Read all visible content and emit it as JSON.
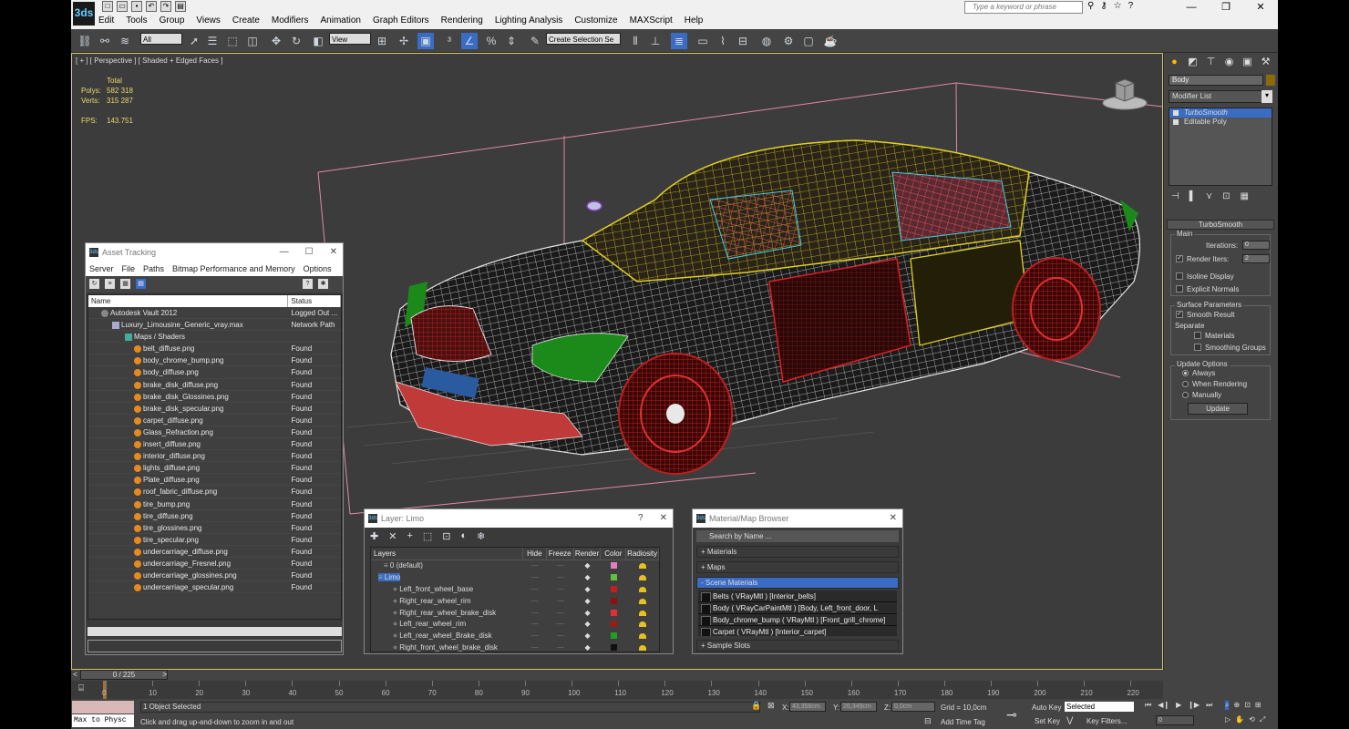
{
  "app": {
    "menus": [
      "Edit",
      "Tools",
      "Group",
      "Views",
      "Create",
      "Modifiers",
      "Animation",
      "Graph Editors",
      "Rendering",
      "Lighting Analysis",
      "Customize",
      "MAXScript",
      "Help"
    ],
    "search_placeholder": "Type a keyword or phrase",
    "logo_text": "3ds"
  },
  "toolbar": {
    "filter_value": "All",
    "coord_value": "View",
    "selection_set_placeholder": "Create Selection Se"
  },
  "viewport": {
    "label": "[ + ] [ Perspective ] [ Shaded + Edged Faces ]",
    "stats": {
      "header": "Total",
      "polys_label": "Polys:",
      "polys_value": "582 318",
      "verts_label": "Verts:",
      "verts_value": "315 287",
      "fps_label": "FPS:",
      "fps_value": "143.751"
    }
  },
  "command_panel": {
    "object_name": "Body",
    "modifier_list": "Modifier List",
    "stack": [
      "TurboSmooth",
      "Editable Poly"
    ],
    "rollout_title": "TurboSmooth",
    "main_label": "Main",
    "iterations_label": "Iterations:",
    "iterations_value": "0",
    "render_iters_label": "Render Iters:",
    "render_iters_value": "2",
    "isoline_label": "Isoline Display",
    "explicit_normals_label": "Explicit Normals",
    "surface_params_label": "Surface Parameters",
    "smooth_result_label": "Smooth Result",
    "separate_label": "Separate",
    "materials_label": "Materials",
    "smoothing_groups_label": "Smoothing Groups",
    "update_options_label": "Update Options",
    "always_label": "Always",
    "when_rendering_label": "When Rendering",
    "manually_label": "Manually",
    "update_button": "Update"
  },
  "asset_tracking": {
    "title": "Asset Tracking",
    "menus": [
      "Server",
      "File",
      "Paths",
      "Bitmap Performance and Memory",
      "Options"
    ],
    "col_name": "Name",
    "col_status": "Status",
    "rows": [
      {
        "name": "Autodesk Vault 2012",
        "status": "Logged Out ...",
        "indent": 0,
        "kind": "vault"
      },
      {
        "name": "Luxury_Limousine_Generic_vray.max",
        "status": "Network Path",
        "indent": 1,
        "kind": "file"
      },
      {
        "name": "Maps / Shaders",
        "status": "",
        "indent": 2,
        "kind": "map"
      },
      {
        "name": "belt_diffuse.png",
        "status": "Found",
        "indent": 3,
        "kind": "img"
      },
      {
        "name": "body_chrome_bump.png",
        "status": "Found",
        "indent": 3,
        "kind": "img"
      },
      {
        "name": "body_diffuse.png",
        "status": "Found",
        "indent": 3,
        "kind": "img"
      },
      {
        "name": "brake_disk_diffuse.png",
        "status": "Found",
        "indent": 3,
        "kind": "img"
      },
      {
        "name": "brake_disk_Glossines.png",
        "status": "Found",
        "indent": 3,
        "kind": "img"
      },
      {
        "name": "brake_disk_specular.png",
        "status": "Found",
        "indent": 3,
        "kind": "img"
      },
      {
        "name": "carpet_diffuse.png",
        "status": "Found",
        "indent": 3,
        "kind": "img"
      },
      {
        "name": "Glass_Refraction.png",
        "status": "Found",
        "indent": 3,
        "kind": "img"
      },
      {
        "name": "insert_diffuse.png",
        "status": "Found",
        "indent": 3,
        "kind": "img"
      },
      {
        "name": "interior_diffuse.png",
        "status": "Found",
        "indent": 3,
        "kind": "img"
      },
      {
        "name": "lights_diffuse.png",
        "status": "Found",
        "indent": 3,
        "kind": "img"
      },
      {
        "name": "Plate_diffuse.png",
        "status": "Found",
        "indent": 3,
        "kind": "img"
      },
      {
        "name": "roof_fabric_diffuse.png",
        "status": "Found",
        "indent": 3,
        "kind": "img"
      },
      {
        "name": "tire_bump.png",
        "status": "Found",
        "indent": 3,
        "kind": "img"
      },
      {
        "name": "tire_diffuse.png",
        "status": "Found",
        "indent": 3,
        "kind": "img"
      },
      {
        "name": "tire_glossines.png",
        "status": "Found",
        "indent": 3,
        "kind": "img"
      },
      {
        "name": "tire_specular.png",
        "status": "Found",
        "indent": 3,
        "kind": "img"
      },
      {
        "name": "undercarriage_diffuse.png",
        "status": "Found",
        "indent": 3,
        "kind": "img"
      },
      {
        "name": "undercarriage_Fresnel.png",
        "status": "Found",
        "indent": 3,
        "kind": "img"
      },
      {
        "name": "undercarriage_glossines.png",
        "status": "Found",
        "indent": 3,
        "kind": "img"
      },
      {
        "name": "undercarriage_specular.png",
        "status": "Found",
        "indent": 3,
        "kind": "img"
      }
    ]
  },
  "layer_dialog": {
    "title": "Layer: Limo",
    "columns": [
      "Layers",
      "Hide",
      "Freeze",
      "Render",
      "Color",
      "Radiosity"
    ],
    "rows": [
      {
        "name": "0 (default)",
        "color": "#e080c0",
        "indent": 1,
        "selected": false
      },
      {
        "name": "Limo",
        "color": "#60c040",
        "indent": 0,
        "selected": true
      },
      {
        "name": "Left_front_wheel_base",
        "color": "#c02020",
        "indent": 2,
        "selected": false
      },
      {
        "name": "Right_rear_wheel_rim",
        "color": "#901010",
        "indent": 2,
        "selected": false
      },
      {
        "name": "Right_rear_wheel_brake_disk",
        "color": "#e03030",
        "indent": 2,
        "selected": false
      },
      {
        "name": "Left_rear_wheel_rim",
        "color": "#a01818",
        "indent": 2,
        "selected": false
      },
      {
        "name": "Left_rear_wheel_Brake_disk",
        "color": "#20a020",
        "indent": 2,
        "selected": false
      },
      {
        "name": "Right_front_wheel_brake_disk",
        "color": "#101010",
        "indent": 2,
        "selected": false
      }
    ]
  },
  "material_browser": {
    "title": "Material/Map Browser",
    "search_placeholder": "Search by Name ...",
    "sections": [
      "+ Materials",
      "+ Maps",
      "- Scene Materials",
      "+ Sample Slots"
    ],
    "items": [
      "Belts ( VRayMtl ) [Interior_belts]",
      "Body ( VRayCarPaintMtl ) [Body, Left_front_door, L",
      "Body_chrome_bump ( VRayMtl ) [Front_grill_chrome]",
      "Carpet ( VRayMtl ) [Interior_carpet]"
    ]
  },
  "timeline": {
    "frame_label": "0 / 225",
    "ticks": [
      0,
      10,
      20,
      30,
      40,
      50,
      60,
      70,
      80,
      90,
      100,
      110,
      120,
      130,
      140,
      150,
      160,
      170,
      180,
      190,
      200,
      210,
      220
    ]
  },
  "status": {
    "maxscript_label": "Max to Physc",
    "selection_info": "1 Object Selected",
    "prompt": "Click and drag up-and-down to zoom in and out",
    "x_label": "X:",
    "x_value": "43,358cm",
    "y_label": "Y:",
    "y_value": "26,349cm",
    "z_label": "Z:",
    "z_value": "0,0cm",
    "grid": "Grid = 10,0cm",
    "add_time_tag": "Add Time Tag",
    "auto_key": "Auto Key",
    "auto_key_value": "Selected",
    "set_key": "Set Key",
    "key_filters": "Key Filters...",
    "frame_value": "0"
  }
}
